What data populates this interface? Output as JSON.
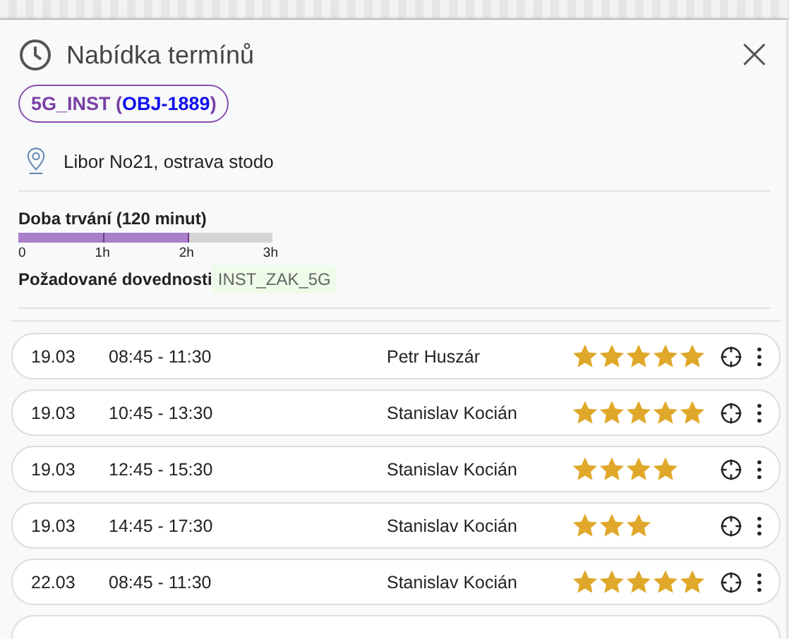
{
  "dialog": {
    "title": "Nabídka termínů",
    "close_label": "×"
  },
  "order": {
    "type": "5G_INST",
    "open": " (",
    "id": "OBJ-1889",
    "close": ")"
  },
  "location": "Libor No21, ostrava stodo",
  "duration": {
    "label": "Doba trvání (120 minut)",
    "level": 0.667,
    "ticks": [
      "0",
      "1h",
      "2h",
      "3h"
    ]
  },
  "skills": {
    "label": "Požadované dovednosti",
    "tags": [
      "INST_ZAK_5G"
    ]
  },
  "slots": [
    {
      "date": "19.03",
      "time": "08:45 - 11:30",
      "technician": "Petr Huszár",
      "stars": 5
    },
    {
      "date": "19.03",
      "time": "10:45 - 13:30",
      "technician": "Stanislav Kocián",
      "stars": 5
    },
    {
      "date": "19.03",
      "time": "12:45 - 15:30",
      "technician": "Stanislav Kocián",
      "stars": 4
    },
    {
      "date": "19.03",
      "time": "14:45 - 17:30",
      "technician": "Stanislav Kocián",
      "stars": 3
    },
    {
      "date": "22.03",
      "time": "08:45 - 11:30",
      "technician": "Stanislav Kocián",
      "stars": 5
    }
  ]
}
